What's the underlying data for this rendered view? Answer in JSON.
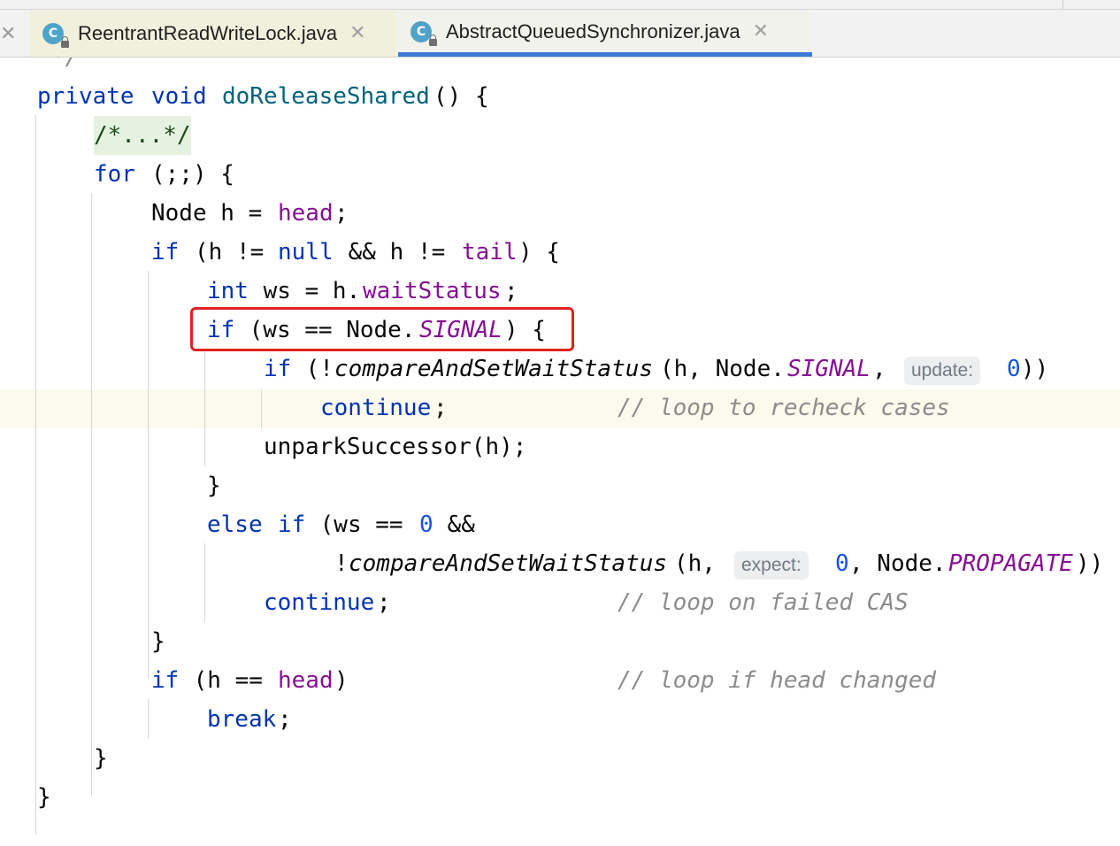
{
  "tabs": [
    {
      "label": "ReentrantReadWriteLock.java",
      "icon": "java-class-icon",
      "icon_letter": "C",
      "active": false
    },
    {
      "label": "AbstractQueuedSynchronizer.java",
      "icon": "java-class-icon",
      "icon_letter": "C",
      "active": true
    }
  ],
  "close_glyph": "✕",
  "colors": {
    "keyword": "#0033b3",
    "field": "#871094",
    "number": "#1750eb",
    "comment": "#8c8c8c",
    "active_tab_underline": "#3b7bd6",
    "highlight_box": "#e02222",
    "current_line": "#fcfaed"
  },
  "code": {
    "l0": "*/",
    "l1": {
      "private": "private",
      "void": "void",
      "method": "doReleaseShared",
      "rest": "() {"
    },
    "l2": "/*...*/",
    "l3": {
      "for": "for",
      "rest": "(;;) {"
    },
    "l4": {
      "a": "Node h = ",
      "head": "head",
      "b": ";"
    },
    "l5": {
      "if": "if",
      "a": "(h != ",
      "null": "null",
      "b": " && h != ",
      "tail": "tail",
      "c": ") {"
    },
    "l6": {
      "int": "int",
      "a": " ws = h.",
      "field": "waitStatus",
      "b": ";"
    },
    "l7": {
      "if": "if",
      "a": " (ws == Node.",
      "signal": "SIGNAL",
      "b": ") {"
    },
    "l8": {
      "if": "if",
      "a": " (!",
      "method": "compareAndSetWaitStatus",
      "b": "(h, Node.",
      "signal": "SIGNAL",
      "c": ",",
      "hint": "update:",
      "num": "0",
      "d": "))"
    },
    "l9": {
      "continue": "continue",
      "a": ";",
      "comment": "// loop to recheck cases"
    },
    "l10": "unparkSuccessor(h);",
    "l11": "}",
    "l12": {
      "else": "else",
      "if": "if",
      "a": " (ws == ",
      "num": "0",
      "b": " &&"
    },
    "l13": {
      "a": "!",
      "method": "compareAndSetWaitStatus",
      "b": "(h,",
      "hint": "expect:",
      "num": "0",
      "c": ", Node.",
      "propagate": "PROPAGATE",
      "d": "))"
    },
    "l14": {
      "continue": "continue",
      "a": ";",
      "comment": "// loop on failed CAS"
    },
    "l15": "}",
    "l16": {
      "if": "if",
      "a": " (h == ",
      "head": "head",
      "b": ")",
      "comment": "// loop if head changed"
    },
    "l17": {
      "break": "break",
      "a": ";"
    },
    "l18": "}",
    "l19": "}"
  }
}
